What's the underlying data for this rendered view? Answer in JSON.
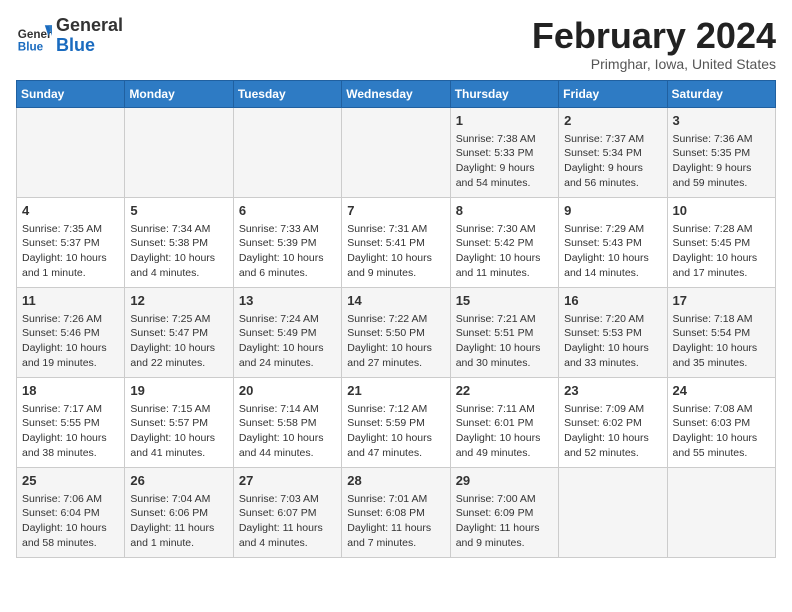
{
  "header": {
    "logo_general": "General",
    "logo_blue": "Blue",
    "month_title": "February 2024",
    "location": "Primghar, Iowa, United States"
  },
  "days_of_week": [
    "Sunday",
    "Monday",
    "Tuesday",
    "Wednesday",
    "Thursday",
    "Friday",
    "Saturday"
  ],
  "weeks": [
    [
      {
        "day": "",
        "info": ""
      },
      {
        "day": "",
        "info": ""
      },
      {
        "day": "",
        "info": ""
      },
      {
        "day": "",
        "info": ""
      },
      {
        "day": "1",
        "info": "Sunrise: 7:38 AM\nSunset: 5:33 PM\nDaylight: 9 hours and 54 minutes."
      },
      {
        "day": "2",
        "info": "Sunrise: 7:37 AM\nSunset: 5:34 PM\nDaylight: 9 hours and 56 minutes."
      },
      {
        "day": "3",
        "info": "Sunrise: 7:36 AM\nSunset: 5:35 PM\nDaylight: 9 hours and 59 minutes."
      }
    ],
    [
      {
        "day": "4",
        "info": "Sunrise: 7:35 AM\nSunset: 5:37 PM\nDaylight: 10 hours and 1 minute."
      },
      {
        "day": "5",
        "info": "Sunrise: 7:34 AM\nSunset: 5:38 PM\nDaylight: 10 hours and 4 minutes."
      },
      {
        "day": "6",
        "info": "Sunrise: 7:33 AM\nSunset: 5:39 PM\nDaylight: 10 hours and 6 minutes."
      },
      {
        "day": "7",
        "info": "Sunrise: 7:31 AM\nSunset: 5:41 PM\nDaylight: 10 hours and 9 minutes."
      },
      {
        "day": "8",
        "info": "Sunrise: 7:30 AM\nSunset: 5:42 PM\nDaylight: 10 hours and 11 minutes."
      },
      {
        "day": "9",
        "info": "Sunrise: 7:29 AM\nSunset: 5:43 PM\nDaylight: 10 hours and 14 minutes."
      },
      {
        "day": "10",
        "info": "Sunrise: 7:28 AM\nSunset: 5:45 PM\nDaylight: 10 hours and 17 minutes."
      }
    ],
    [
      {
        "day": "11",
        "info": "Sunrise: 7:26 AM\nSunset: 5:46 PM\nDaylight: 10 hours and 19 minutes."
      },
      {
        "day": "12",
        "info": "Sunrise: 7:25 AM\nSunset: 5:47 PM\nDaylight: 10 hours and 22 minutes."
      },
      {
        "day": "13",
        "info": "Sunrise: 7:24 AM\nSunset: 5:49 PM\nDaylight: 10 hours and 24 minutes."
      },
      {
        "day": "14",
        "info": "Sunrise: 7:22 AM\nSunset: 5:50 PM\nDaylight: 10 hours and 27 minutes."
      },
      {
        "day": "15",
        "info": "Sunrise: 7:21 AM\nSunset: 5:51 PM\nDaylight: 10 hours and 30 minutes."
      },
      {
        "day": "16",
        "info": "Sunrise: 7:20 AM\nSunset: 5:53 PM\nDaylight: 10 hours and 33 minutes."
      },
      {
        "day": "17",
        "info": "Sunrise: 7:18 AM\nSunset: 5:54 PM\nDaylight: 10 hours and 35 minutes."
      }
    ],
    [
      {
        "day": "18",
        "info": "Sunrise: 7:17 AM\nSunset: 5:55 PM\nDaylight: 10 hours and 38 minutes."
      },
      {
        "day": "19",
        "info": "Sunrise: 7:15 AM\nSunset: 5:57 PM\nDaylight: 10 hours and 41 minutes."
      },
      {
        "day": "20",
        "info": "Sunrise: 7:14 AM\nSunset: 5:58 PM\nDaylight: 10 hours and 44 minutes."
      },
      {
        "day": "21",
        "info": "Sunrise: 7:12 AM\nSunset: 5:59 PM\nDaylight: 10 hours and 47 minutes."
      },
      {
        "day": "22",
        "info": "Sunrise: 7:11 AM\nSunset: 6:01 PM\nDaylight: 10 hours and 49 minutes."
      },
      {
        "day": "23",
        "info": "Sunrise: 7:09 AM\nSunset: 6:02 PM\nDaylight: 10 hours and 52 minutes."
      },
      {
        "day": "24",
        "info": "Sunrise: 7:08 AM\nSunset: 6:03 PM\nDaylight: 10 hours and 55 minutes."
      }
    ],
    [
      {
        "day": "25",
        "info": "Sunrise: 7:06 AM\nSunset: 6:04 PM\nDaylight: 10 hours and 58 minutes."
      },
      {
        "day": "26",
        "info": "Sunrise: 7:04 AM\nSunset: 6:06 PM\nDaylight: 11 hours and 1 minute."
      },
      {
        "day": "27",
        "info": "Sunrise: 7:03 AM\nSunset: 6:07 PM\nDaylight: 11 hours and 4 minutes."
      },
      {
        "day": "28",
        "info": "Sunrise: 7:01 AM\nSunset: 6:08 PM\nDaylight: 11 hours and 7 minutes."
      },
      {
        "day": "29",
        "info": "Sunrise: 7:00 AM\nSunset: 6:09 PM\nDaylight: 11 hours and 9 minutes."
      },
      {
        "day": "",
        "info": ""
      },
      {
        "day": "",
        "info": ""
      }
    ]
  ]
}
